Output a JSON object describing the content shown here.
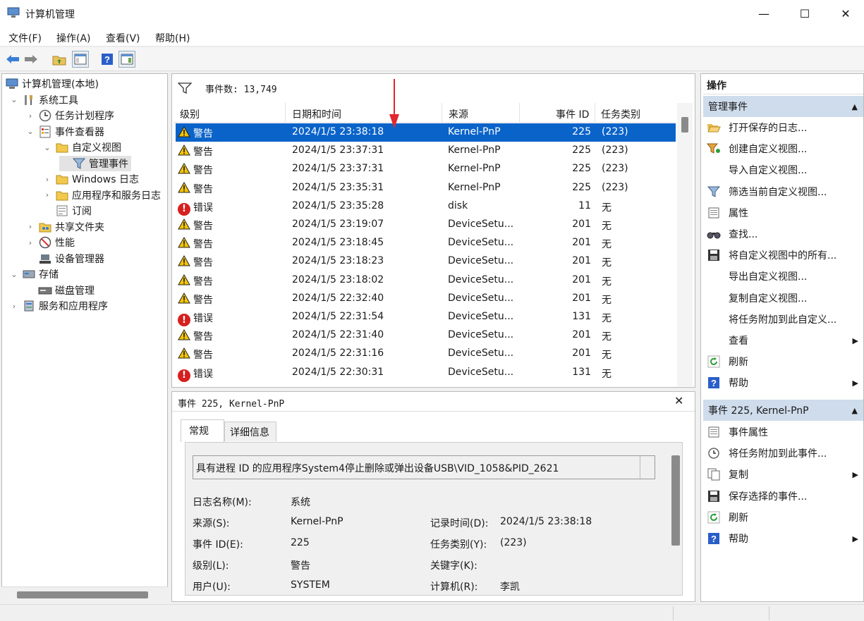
{
  "window": {
    "title": "计算机管理"
  },
  "menu": [
    "文件(F)",
    "操作(A)",
    "查看(V)",
    "帮助(H)"
  ],
  "tree": [
    {
      "label": "计算机管理(本地)",
      "level": 0,
      "chev": "",
      "icon": "computer-icon"
    },
    {
      "label": "系统工具",
      "level": 1,
      "chev": "⌄",
      "icon": "tools-icon"
    },
    {
      "label": "任务计划程序",
      "level": 2,
      "chev": "›",
      "icon": "clock-icon"
    },
    {
      "label": "事件查看器",
      "level": 2,
      "chev": "⌄",
      "icon": "event-viewer-icon"
    },
    {
      "label": "自定义视图",
      "level": 3,
      "chev": "⌄",
      "icon": "folder-icon"
    },
    {
      "label": "管理事件",
      "level": 4,
      "chev": "",
      "icon": "filter-icon",
      "selected": true
    },
    {
      "label": "Windows 日志",
      "level": 3,
      "chev": "›",
      "icon": "folder-icon"
    },
    {
      "label": "应用程序和服务日志",
      "level": 3,
      "chev": "›",
      "icon": "folder-icon"
    },
    {
      "label": "订阅",
      "level": 3,
      "chev": "",
      "icon": "subscription-icon"
    },
    {
      "label": "共享文件夹",
      "level": 2,
      "chev": "›",
      "icon": "shared-folder-icon"
    },
    {
      "label": "性能",
      "level": 2,
      "chev": "›",
      "icon": "performance-icon"
    },
    {
      "label": "设备管理器",
      "level": 2,
      "chev": "",
      "icon": "device-manager-icon"
    },
    {
      "label": "存储",
      "level": 1,
      "chev": "⌄",
      "icon": "storage-icon"
    },
    {
      "label": "磁盘管理",
      "level": 2,
      "chev": "",
      "icon": "disk-icon"
    },
    {
      "label": "服务和应用程序",
      "level": 1,
      "chev": "›",
      "icon": "services-icon"
    }
  ],
  "events": {
    "count_label": "事件数: 13,749",
    "columns": [
      "级别",
      "日期和时间",
      "来源",
      "事件 ID",
      "任务类别"
    ],
    "rows": [
      {
        "level": "警告",
        "type": "warning",
        "datetime": "2024/1/5 23:38:18",
        "source": "Kernel-PnP",
        "id": "225",
        "task": "(223)",
        "selected": true
      },
      {
        "level": "警告",
        "type": "warning",
        "datetime": "2024/1/5 23:37:31",
        "source": "Kernel-PnP",
        "id": "225",
        "task": "(223)"
      },
      {
        "level": "警告",
        "type": "warning",
        "datetime": "2024/1/5 23:37:31",
        "source": "Kernel-PnP",
        "id": "225",
        "task": "(223)"
      },
      {
        "level": "警告",
        "type": "warning",
        "datetime": "2024/1/5 23:35:31",
        "source": "Kernel-PnP",
        "id": "225",
        "task": "(223)"
      },
      {
        "level": "错误",
        "type": "error",
        "datetime": "2024/1/5 23:35:28",
        "source": "disk",
        "id": "11",
        "task": "无"
      },
      {
        "level": "警告",
        "type": "warning",
        "datetime": "2024/1/5 23:19:07",
        "source": "DeviceSetu...",
        "id": "201",
        "task": "无"
      },
      {
        "level": "警告",
        "type": "warning",
        "datetime": "2024/1/5 23:18:45",
        "source": "DeviceSetu...",
        "id": "201",
        "task": "无"
      },
      {
        "level": "警告",
        "type": "warning",
        "datetime": "2024/1/5 23:18:23",
        "source": "DeviceSetu...",
        "id": "201",
        "task": "无"
      },
      {
        "level": "警告",
        "type": "warning",
        "datetime": "2024/1/5 23:18:02",
        "source": "DeviceSetu...",
        "id": "201",
        "task": "无"
      },
      {
        "level": "警告",
        "type": "warning",
        "datetime": "2024/1/5 22:32:40",
        "source": "DeviceSetu...",
        "id": "201",
        "task": "无"
      },
      {
        "level": "错误",
        "type": "error",
        "datetime": "2024/1/5 22:31:54",
        "source": "DeviceSetu...",
        "id": "131",
        "task": "无"
      },
      {
        "level": "警告",
        "type": "warning",
        "datetime": "2024/1/5 22:31:40",
        "source": "DeviceSetu...",
        "id": "201",
        "task": "无"
      },
      {
        "level": "警告",
        "type": "warning",
        "datetime": "2024/1/5 22:31:16",
        "source": "DeviceSetu...",
        "id": "201",
        "task": "无"
      },
      {
        "level": "错误",
        "type": "error",
        "datetime": "2024/1/5 22:30:31",
        "source": "DeviceSetu...",
        "id": "131",
        "task": "无"
      }
    ]
  },
  "detail": {
    "header": "事件 225, Kernel-PnP",
    "tabs": [
      "常规",
      "详细信息"
    ],
    "description": "具有进程 ID 的应用程序System4停止删除或弹出设备USB\\VID_1058&PID_2621",
    "fields_left": [
      {
        "label": "日志名称(M):",
        "value": "系统"
      },
      {
        "label": "来源(S):",
        "value": "Kernel-PnP"
      },
      {
        "label": "事件 ID(E):",
        "value": "225"
      },
      {
        "label": "级别(L):",
        "value": "警告"
      },
      {
        "label": "用户(U):",
        "value": "SYSTEM"
      }
    ],
    "fields_right": [
      {
        "label": "记录时间(D):",
        "value": "2024/1/5 23:38:18"
      },
      {
        "label": "任务类别(Y):",
        "value": "(223)"
      },
      {
        "label": "关键字(K):",
        "value": ""
      },
      {
        "label": "计算机(R):",
        "value": "李凯"
      }
    ]
  },
  "actions": {
    "title": "操作",
    "section1": {
      "header": "管理事件",
      "items": [
        {
          "label": "打开保存的日志...",
          "icon": "open-folder-icon"
        },
        {
          "label": "创建自定义视图...",
          "icon": "create-filter-icon"
        },
        {
          "label": "导入自定义视图...",
          "icon": ""
        },
        {
          "label": "筛选当前自定义视图...",
          "icon": "filter-icon"
        },
        {
          "label": "属性",
          "icon": "properties-icon"
        },
        {
          "label": "查找...",
          "icon": "find-icon"
        },
        {
          "label": "将自定义视图中的所有...",
          "icon": "save-icon"
        },
        {
          "label": "导出自定义视图...",
          "icon": ""
        },
        {
          "label": "复制自定义视图...",
          "icon": ""
        },
        {
          "label": "将任务附加到此自定义...",
          "icon": ""
        },
        {
          "label": "查看",
          "icon": "",
          "submenu": true
        },
        {
          "label": "刷新",
          "icon": "refresh-icon"
        },
        {
          "label": "帮助",
          "icon": "help-icon",
          "submenu": true
        }
      ]
    },
    "section2": {
      "header": "事件 225, Kernel-PnP",
      "items": [
        {
          "label": "事件属性",
          "icon": "properties-icon"
        },
        {
          "label": "将任务附加到此事件...",
          "icon": "task-icon"
        },
        {
          "label": "复制",
          "icon": "copy-icon",
          "submenu": true
        },
        {
          "label": "保存选择的事件...",
          "icon": "save-icon"
        },
        {
          "label": "刷新",
          "icon": "refresh-icon"
        },
        {
          "label": "帮助",
          "icon": "help-icon",
          "submenu": true
        }
      ]
    }
  },
  "colors": {
    "selection": "#0a63c9",
    "section_header": "#cfdcec",
    "annotation_arrow": "#e0282e"
  }
}
